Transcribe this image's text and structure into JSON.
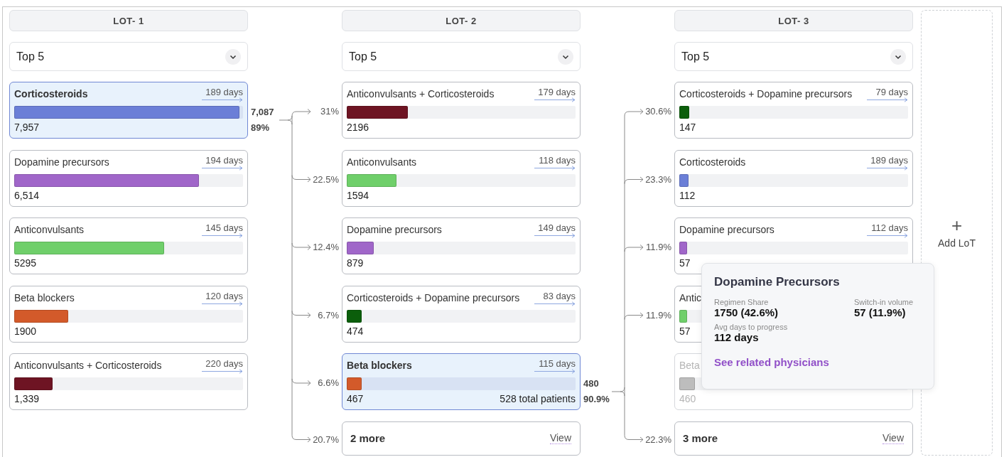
{
  "lots": [
    {
      "title": "LOT- 1",
      "filter": "Top 5",
      "cards": [
        {
          "name": "Corticosteroids",
          "days": "189 days",
          "value": "7,957",
          "level": 1,
          "color": "#6b7fd7",
          "selected": true,
          "disabled": false,
          "outflow": {
            "count": "7,087",
            "share": "89%"
          }
        },
        {
          "name": "Dopamine precursors",
          "days": "194 days",
          "value": "6,514",
          "level": 0.82,
          "color": "#a066c9",
          "selected": false,
          "disabled": false
        },
        {
          "name": "Anticonvulsants",
          "days": "145 days",
          "value": "5295",
          "level": 0.665,
          "color": "#6fcf6a",
          "selected": false,
          "disabled": false
        },
        {
          "name": "Beta blockers",
          "days": "120 days",
          "value": "1900",
          "level": 0.24,
          "color": "#d35a2a",
          "selected": false,
          "disabled": false
        },
        {
          "name": "Anticonvulsants + Corticosteroids",
          "days": "220 days",
          "value": "1,339",
          "level": 0.17,
          "color": "#6e1423",
          "selected": false,
          "disabled": false
        }
      ]
    },
    {
      "title": "LOT- 2",
      "filter": "Top 5",
      "cards": [
        {
          "name": "Anticonvulsants + Corticosteroids",
          "days": "179 days",
          "value": "2196",
          "level": 0.27,
          "color": "#6e1423",
          "selected": false,
          "disabled": false,
          "inflow": "31%"
        },
        {
          "name": "Anticonvulsants",
          "days": "118 days",
          "value": "1594",
          "level": 0.22,
          "color": "#6fcf6a",
          "selected": false,
          "disabled": false,
          "inflow": "22.5%"
        },
        {
          "name": "Dopamine precursors",
          "days": "149 days",
          "value": "879",
          "level": 0.12,
          "color": "#a066c9",
          "selected": false,
          "disabled": false,
          "inflow": "12.4%"
        },
        {
          "name": "Corticosteroids + Dopamine precursors",
          "days": "83 days",
          "value": "474",
          "level": 0.065,
          "color": "#0b5e0b",
          "selected": false,
          "disabled": false,
          "inflow": "6.7%"
        },
        {
          "name": "Beta blockers",
          "days": "115 days",
          "value": "467",
          "total": "528 total patients",
          "level": 0.065,
          "color": "#d35a2a",
          "selected": true,
          "disabled": false,
          "inflow": "6.6%",
          "outflow": {
            "count": "480",
            "share": "90.9%"
          }
        }
      ],
      "more": {
        "label": "2 more",
        "action": "View",
        "inflow": "20.7%"
      }
    },
    {
      "title": "LOT- 3",
      "filter": "Top 5",
      "cards": [
        {
          "name": "Corticosteroids + Dopamine precursors",
          "days": "79 days",
          "value": "147",
          "level": 0.045,
          "color": "#0b5e0b",
          "selected": false,
          "disabled": false,
          "inflow": "30.6%"
        },
        {
          "name": "Corticosteroids",
          "days": "189 days",
          "value": "112",
          "level": 0.04,
          "color": "#6b7fd7",
          "selected": false,
          "disabled": false,
          "inflow": "23.3%"
        },
        {
          "name": "Dopamine precursors",
          "days": "112 days",
          "value": "57",
          "level": 0.035,
          "color": "#a066c9",
          "selected": false,
          "disabled": false,
          "inflow": "11.9%"
        },
        {
          "name": "Antic",
          "value": "57",
          "level": 0.035,
          "color": "#6fcf6a",
          "selected": false,
          "disabled": false,
          "inflow": "11.9%"
        },
        {
          "name": "Beta",
          "value": "460",
          "level": 0.07,
          "color": "#bdbdbd",
          "selected": false,
          "disabled": true
        }
      ],
      "more": {
        "label": "3 more",
        "action": "View",
        "inflow": "22.3%"
      }
    }
  ],
  "add_lot": {
    "icon": "+",
    "label": "Add LoT"
  },
  "tooltip": {
    "title": "Dopamine Precursors",
    "fields": [
      {
        "label": "Regimen Share",
        "value": "1750 (42.6%)"
      },
      {
        "label": "Switch-in volume",
        "value": "57 (11.9%)"
      },
      {
        "label": "Avg days to progress",
        "value": "112 days"
      }
    ],
    "link": "See related physicians"
  }
}
